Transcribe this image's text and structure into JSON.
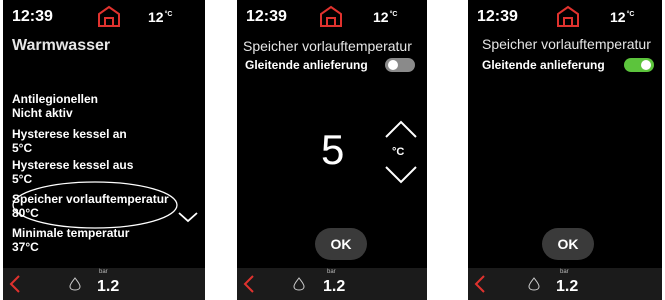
{
  "status": {
    "time": "12:39",
    "temp": "12",
    "temp_unit": "°C"
  },
  "bottom": {
    "bar_label": "bar",
    "pressure": "1.2"
  },
  "screen1": {
    "title": "Warmwasser",
    "items": [
      {
        "label": "Antilegionellen",
        "value": "Nicht aktiv"
      },
      {
        "label": "Hysterese kessel an",
        "value": "5°C"
      },
      {
        "label": "Hysterese kessel aus",
        "value": "5°C"
      },
      {
        "label": "Speicher vorlauftemperatur",
        "value": "80°C"
      },
      {
        "label": "Minimale temperatur",
        "value": "37°C"
      }
    ]
  },
  "screen2": {
    "title": "Speicher vorlauftemperatur",
    "toggle_label": "Gleitende anlieferung",
    "toggle_on": false,
    "value": "5",
    "unit": "°C",
    "ok": "OK"
  },
  "screen3": {
    "title": "Speicher vorlauftemperatur",
    "toggle_label": "Gleitende anlieferung",
    "toggle_on": true,
    "ok": "OK"
  },
  "colors": {
    "accent_red": "#e0322e",
    "toggle_on": "#5cc43c",
    "toggle_off": "#8a8a8a"
  }
}
